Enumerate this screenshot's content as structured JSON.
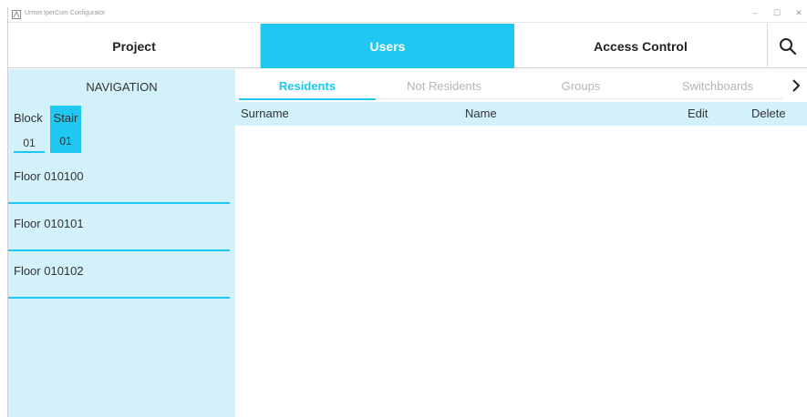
{
  "window": {
    "title": "Urmet IperCom Configurator",
    "controls": {
      "minimize": "–",
      "maximize": "☐",
      "close": "✕"
    }
  },
  "topnav": {
    "items": [
      {
        "label": "Project"
      },
      {
        "label": "Users",
        "active": true
      },
      {
        "label": "Access Control"
      }
    ],
    "search_icon": "search-icon"
  },
  "colors": {
    "accent": "#1ec8f0",
    "sidebar_bg": "#d2f1fb"
  },
  "sidebar": {
    "title": "NAVIGATION",
    "block": {
      "label": "Block",
      "value": "01"
    },
    "stair": {
      "label": "Stair",
      "value": "01"
    },
    "floors": [
      {
        "label": "Floor 010100"
      },
      {
        "label": "Floor 010101"
      },
      {
        "label": "Floor 010102"
      }
    ]
  },
  "tabs": {
    "items": [
      {
        "label": "Residents",
        "active": true
      },
      {
        "label": "Not Residents"
      },
      {
        "label": "Groups"
      },
      {
        "label": "Switchboards"
      }
    ],
    "next_icon": "chevron-right-icon"
  },
  "table": {
    "columns": [
      "Surname",
      "Name",
      "Edit",
      "Delete"
    ],
    "rows": []
  }
}
